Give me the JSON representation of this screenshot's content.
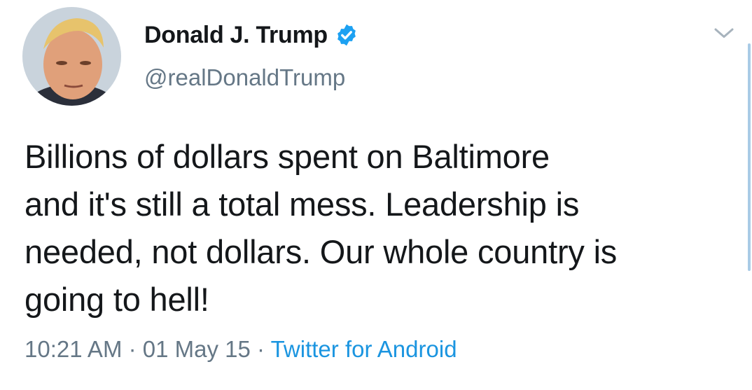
{
  "tweet": {
    "display_name": "Donald J. Trump",
    "handle": "@realDonaldTrump",
    "text_lines": [
      "Billions of dollars spent on Baltimore",
      "and it's still a total mess. Leadership is",
      "needed, not dollars. Our whole country is",
      "going to hell!"
    ],
    "time": "10:21 AM",
    "date": "01 May 15",
    "separator": " · ",
    "source": "Twitter for Android"
  },
  "icons": {
    "verified": "verified-badge-icon",
    "menu": "chevron-down-icon"
  },
  "colors": {
    "text": "#14171a",
    "secondary": "#657786",
    "link": "#1b95e0",
    "verified": "#1da1f2"
  }
}
